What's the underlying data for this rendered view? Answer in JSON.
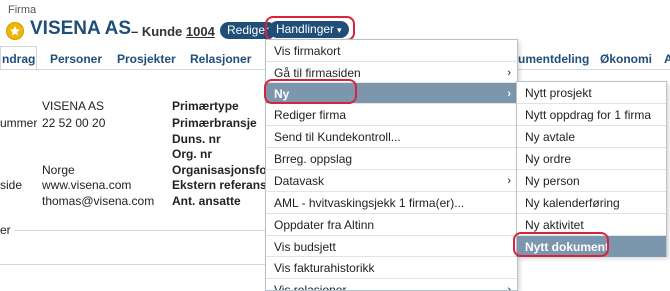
{
  "header": {
    "section_label": "Firma",
    "company_name": "VISENA AS",
    "kunde_label": "– Kunde",
    "kunde_nr": "1004",
    "rediger_label": "Rediger",
    "handlinger_label": "Handlinger"
  },
  "tabs": [
    "ndrag",
    "Personer",
    "Prosjekter",
    "Relasjoner",
    "umentdeling",
    "Økonomi",
    "A"
  ],
  "info": {
    "left_labels": [
      "ummer",
      "side"
    ],
    "left_values": [
      "VISENA AS",
      "22 52 00 20",
      "Norge",
      "www.visena.com",
      "thomas@visena.com"
    ],
    "right_labels": [
      "Primærtype",
      "Primærbransje",
      "Duns. nr",
      "Org. nr",
      "Organisasjonsform",
      "Ekstern referanse",
      "Ant. ansatte"
    ],
    "section_partial": "er"
  },
  "menu": {
    "items": [
      {
        "label": "Vis firmakort",
        "arrow": ""
      },
      {
        "label": "Gå til firmasiden",
        "arrow": "›"
      },
      {
        "label": "Ny",
        "arrow": "›"
      },
      {
        "label": "Rediger firma",
        "arrow": ""
      },
      {
        "label": "Send til Kundekontroll...",
        "arrow": ""
      },
      {
        "label": "Brreg. oppslag",
        "arrow": ""
      },
      {
        "label": "Datavask",
        "arrow": "›"
      },
      {
        "label": "AML - hvitvaskingsjekk 1 firma(er)...",
        "arrow": ""
      },
      {
        "label": "Oppdater fra Altinn",
        "arrow": ""
      },
      {
        "label": "Vis budsjett",
        "arrow": ""
      },
      {
        "label": "Vis fakturahistorikk",
        "arrow": ""
      },
      {
        "label": "Vis relasjoner",
        "arrow": "›"
      }
    ]
  },
  "submenu": {
    "items": [
      "Nytt prosjekt",
      "Nytt oppdrag for 1 firma",
      "Ny avtale",
      "Ny ordre",
      "Ny person",
      "Ny kalenderføring",
      "Ny aktivitet",
      "Nytt dokument"
    ]
  },
  "colors": {
    "brand": "#1f4e79",
    "highlight_outline": "#d9223c",
    "menu_hover": "#7b96ad",
    "star": "#f2b705"
  }
}
